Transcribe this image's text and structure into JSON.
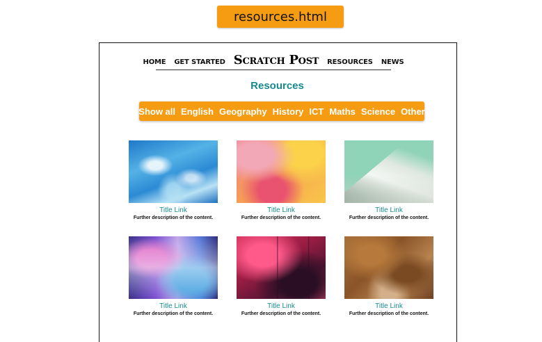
{
  "file_tab": {
    "label": "resources.html"
  },
  "nav": {
    "items": [
      "HOME",
      "GET STARTED",
      "RESOURCES",
      "NEWS"
    ],
    "brand": "Scratch Post"
  },
  "heading": "Resources",
  "filters": [
    "Show all",
    "English",
    "Geography",
    "History",
    "ICT",
    "Maths",
    "Science",
    "Other"
  ],
  "cards": [
    {
      "title": "Title Link",
      "description": "Further description of the content."
    },
    {
      "title": "Title Link",
      "description": "Further description of the content."
    },
    {
      "title": "Title Link",
      "description": "Further description of the content."
    },
    {
      "title": "Title Link",
      "description": "Further description of the content."
    },
    {
      "title": "Title Link",
      "description": "Further description of the content."
    },
    {
      "title": "Title Link",
      "description": "Further description of the content."
    }
  ],
  "colors": {
    "accent_orange": "#f59c12",
    "link_teal": "#178a8c"
  }
}
